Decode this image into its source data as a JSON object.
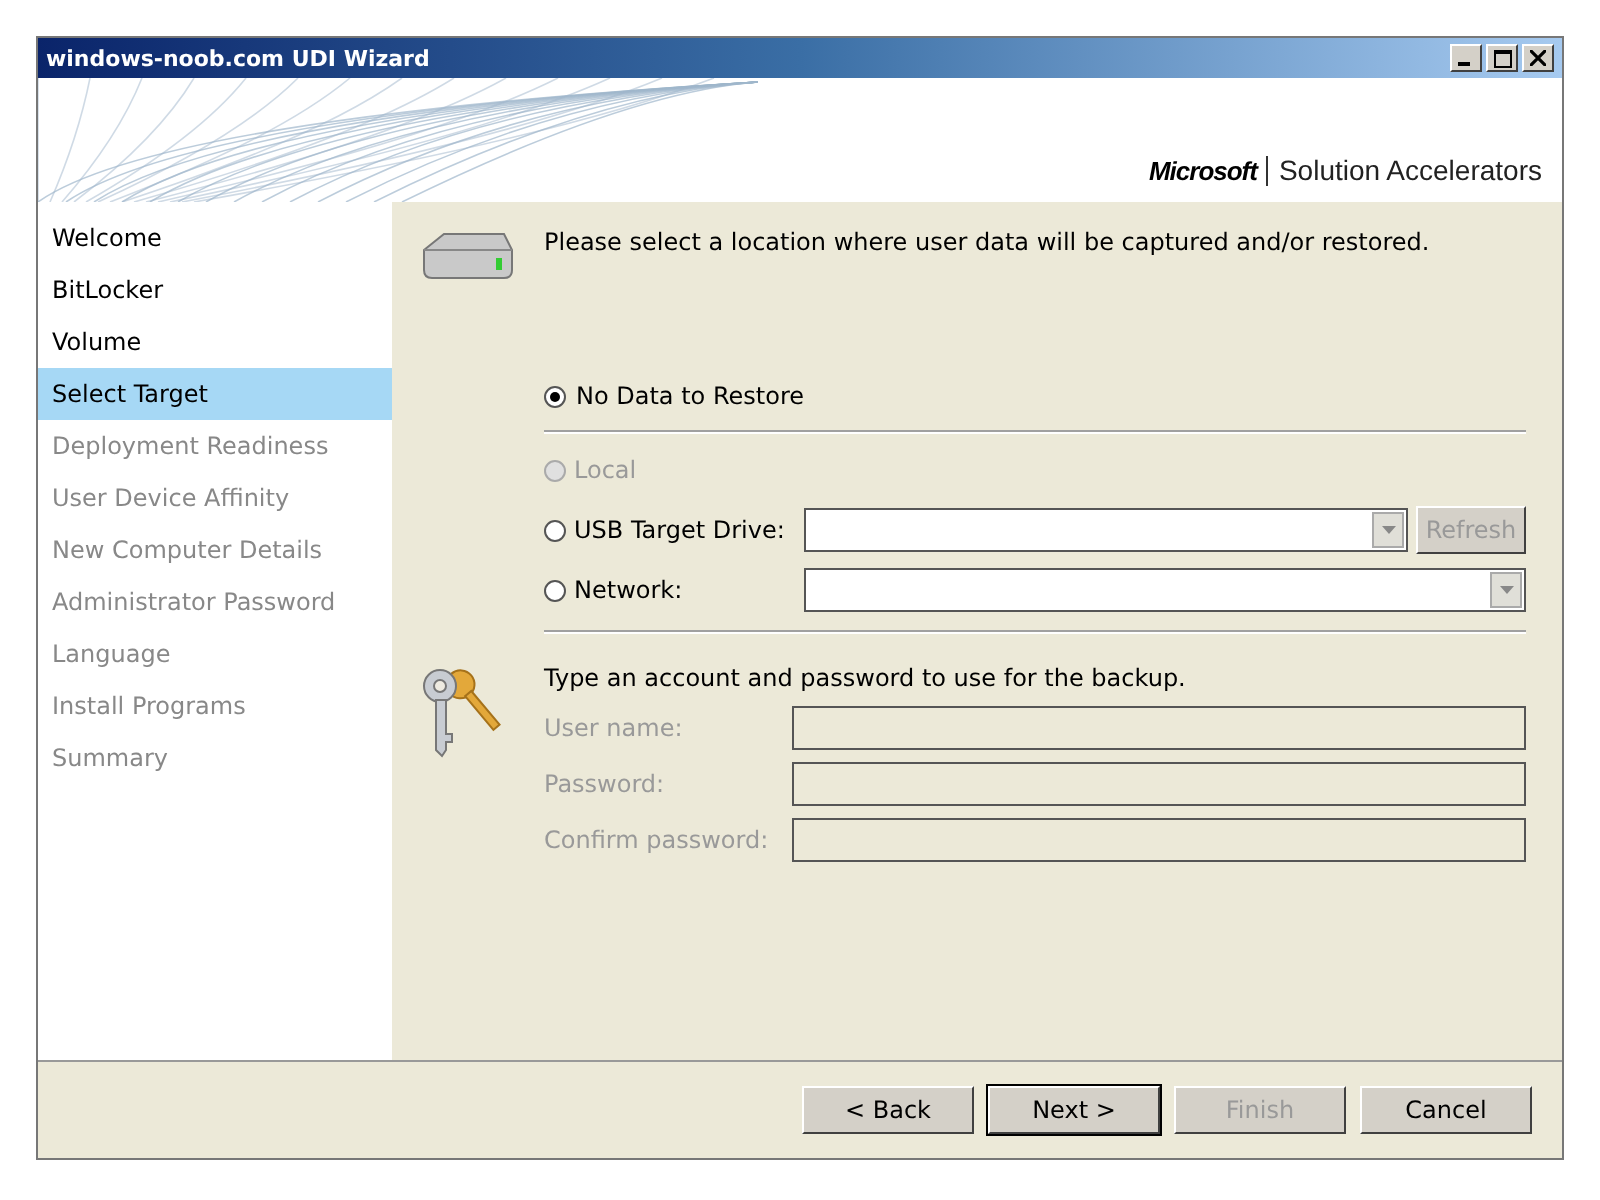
{
  "window": {
    "title": "windows-noob.com UDI Wizard"
  },
  "header": {
    "brand": "Microsoft",
    "product": "Solution Accelerators"
  },
  "sidebar": {
    "items": [
      {
        "label": "Welcome",
        "selected": false,
        "disabled": false
      },
      {
        "label": "BitLocker",
        "selected": false,
        "disabled": false
      },
      {
        "label": "Volume",
        "selected": false,
        "disabled": false
      },
      {
        "label": "Select Target",
        "selected": true,
        "disabled": false
      },
      {
        "label": "Deployment Readiness",
        "selected": false,
        "disabled": true
      },
      {
        "label": "User Device Affinity",
        "selected": false,
        "disabled": true
      },
      {
        "label": "New Computer Details",
        "selected": false,
        "disabled": true
      },
      {
        "label": "Administrator Password",
        "selected": false,
        "disabled": true
      },
      {
        "label": "Language",
        "selected": false,
        "disabled": true
      },
      {
        "label": "Install Programs",
        "selected": false,
        "disabled": true
      },
      {
        "label": "Summary",
        "selected": false,
        "disabled": true
      }
    ]
  },
  "target": {
    "intro": "Please select a location where user data will be captured and/or restored.",
    "primary_option": {
      "label": "No Data to Restore",
      "selected": true,
      "disabled": false
    },
    "locations": [
      {
        "kind": "plain",
        "label": "Local",
        "selected": false,
        "disabled": true
      },
      {
        "kind": "combo-refresh",
        "label": "USB Target Drive:",
        "selected": false,
        "disabled": false,
        "refresh": {
          "label": "Refresh",
          "disabled": true
        }
      },
      {
        "kind": "combo",
        "label": "Network:",
        "selected": false,
        "disabled": false
      }
    ]
  },
  "credentials": {
    "intro": "Type an account and password to use for the backup.",
    "fields": [
      {
        "label": "User name:",
        "disabled": true
      },
      {
        "label": "Password:",
        "disabled": true
      },
      {
        "label": "Confirm password:",
        "disabled": true
      }
    ]
  },
  "buttons": [
    {
      "label": "< Back",
      "disabled": false,
      "default": false
    },
    {
      "label": "Next >",
      "disabled": false,
      "default": true
    },
    {
      "label": "Finish",
      "disabled": true,
      "default": false
    },
    {
      "label": "Cancel",
      "disabled": false,
      "default": false
    }
  ]
}
